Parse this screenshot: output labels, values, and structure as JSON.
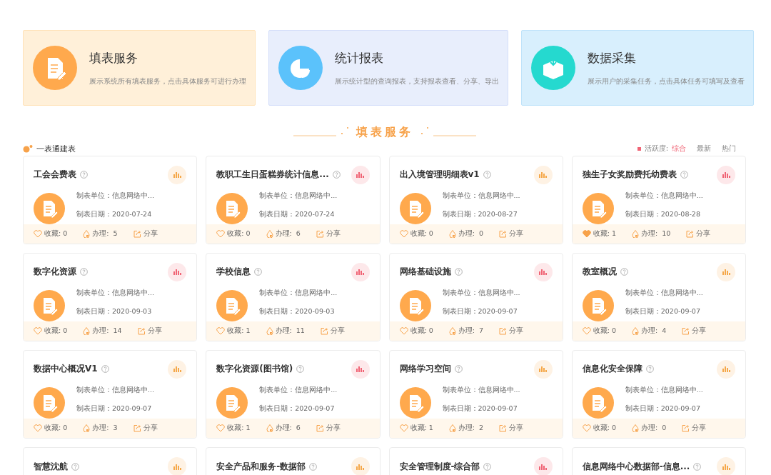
{
  "services": [
    {
      "kind": "form",
      "title": "填表服务",
      "description": "展示系统所有填表服务，点击具体服务可进行办理"
    },
    {
      "kind": "report",
      "title": "统计报表",
      "description": "展示统计型的查询报表，支持报表查看、分享、导出"
    },
    {
      "kind": "collect",
      "title": "数据采集",
      "description": "展示用户的采集任务，点击具体任务可填写及查看"
    }
  ],
  "section_title": "填表服务",
  "group_label": "一表通建表",
  "sort": {
    "label": "活跃度:",
    "options": [
      {
        "label": "综合",
        "selected": true
      },
      {
        "label": "最新",
        "selected": false
      },
      {
        "label": "热门",
        "selected": false
      }
    ]
  },
  "cards": [
    {
      "title": "工会会费表",
      "color": "#f5a84a",
      "unit": "制表单位：信息网络中...",
      "date": "制表日期：2020-07-24",
      "favorites": "收藏: 0",
      "favorited": false,
      "handled": "办理:  5",
      "share": "分享"
    },
    {
      "title": "教职工生日蛋糕券统计信息...",
      "color": "#f06475",
      "unit": "制表单位：信息网络中...",
      "date": "制表日期：2020-07-24",
      "favorites": "收藏: 0",
      "favorited": false,
      "handled": "办理:  6",
      "share": "分享"
    },
    {
      "title": "出入境管理明细表v1",
      "color": "#f5a84a",
      "unit": "制表单位：信息网络中...",
      "date": "制表日期：2020-08-27",
      "favorites": "收藏: 0",
      "favorited": false,
      "handled": "办理:  0",
      "share": "分享"
    },
    {
      "title": "独生子女奖励费托幼费表",
      "color": "#f06475",
      "unit": "制表单位：信息网络中...",
      "date": "制表日期：2020-08-28",
      "favorites": "收藏: 1",
      "favorited": true,
      "handled": "办理:  10",
      "share": "分享"
    },
    {
      "title": "数字化资源",
      "color": "#f06475",
      "unit": "制表单位：信息网络中...",
      "date": "制表日期：2020-09-03",
      "favorites": "收藏: 0",
      "favorited": false,
      "handled": "办理:  14",
      "share": "分享"
    },
    {
      "title": "学校信息",
      "color": "#f06475",
      "unit": "制表单位：信息网络中...",
      "date": "制表日期：2020-09-03",
      "favorites": "收藏: 1",
      "favorited": false,
      "handled": "办理:  11",
      "share": "分享"
    },
    {
      "title": "网络基础设施",
      "color": "#f06475",
      "unit": "制表单位：信息网络中...",
      "date": "制表日期：2020-09-07",
      "favorites": "收藏: 0",
      "favorited": false,
      "handled": "办理:  7",
      "share": "分享"
    },
    {
      "title": "教室概况",
      "color": "#f5a84a",
      "unit": "制表单位：信息网络中...",
      "date": "制表日期：2020-09-07",
      "favorites": "收藏: 0",
      "favorited": false,
      "handled": "办理:  4",
      "share": "分享"
    },
    {
      "title": "数据中心概况V1",
      "color": "#f5a84a",
      "unit": "制表单位：信息网络中...",
      "date": "制表日期：2020-09-07",
      "favorites": "收藏: 0",
      "favorited": false,
      "handled": "办理:  3",
      "share": "分享"
    },
    {
      "title": "数字化资源(图书馆)",
      "color": "#f06475",
      "unit": "制表单位：信息网络中...",
      "date": "制表日期：2020-09-07",
      "favorites": "收藏: 1",
      "favorited": false,
      "handled": "办理:  6",
      "share": "分享"
    },
    {
      "title": "网络学习空间",
      "color": "#f5a84a",
      "unit": "制表单位：信息网络中...",
      "date": "制表日期：2020-09-07",
      "favorites": "收藏: 1",
      "favorited": false,
      "handled": "办理:  2",
      "share": "分享"
    },
    {
      "title": "信息化安全保障",
      "color": "#f5a84a",
      "unit": "制表单位：信息网络中...",
      "date": "制表日期：2020-09-07",
      "favorites": "收藏: 0",
      "favorited": false,
      "handled": "办理:  0",
      "share": "分享"
    },
    {
      "title": "智慧沈航",
      "color": "#f5a84a"
    },
    {
      "title": "安全产品和服务-数据部",
      "color": "#f5a84a"
    },
    {
      "title": "安全管理制度-综合部",
      "color": "#f06475"
    },
    {
      "title": "信息网络中心数据部-信息...",
      "color": "#f5a84a"
    }
  ]
}
